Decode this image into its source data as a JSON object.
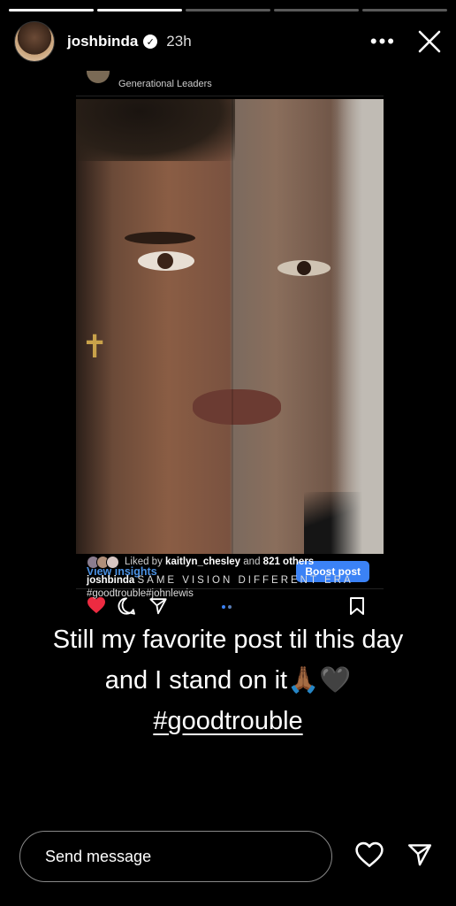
{
  "story": {
    "progress": [
      1,
      1,
      0,
      0,
      0
    ],
    "header": {
      "username": "joshbinda",
      "time": "23h"
    },
    "post": {
      "author_label": "Generational Leaders",
      "view_insights": "View insights",
      "boost_label": "Boost post",
      "likes_prefix": "Liked by ",
      "likes_user": "kaitlyn_chesley",
      "likes_mid": " and ",
      "likes_count": "821 others",
      "caption_user": "joshbinda",
      "caption_text": "SAME VISION DIFFERENT ERA",
      "caption_tags": "#goodtrouble#johnlewis"
    },
    "text": {
      "line1": "Still my favorite post til this day",
      "line2": "and I stand on it🙏🏾🖤",
      "hashtag": "#goodtrouble"
    },
    "footer": {
      "message_placeholder": "Send message"
    }
  },
  "colors": {
    "accent_blue": "#3b82f6",
    "like_red": "#ed2b41"
  },
  "icons": [
    "verified-badge-icon",
    "more-icon",
    "close-icon",
    "heart-icon",
    "comment-icon",
    "share-icon",
    "bookmark-icon",
    "send-icon"
  ]
}
